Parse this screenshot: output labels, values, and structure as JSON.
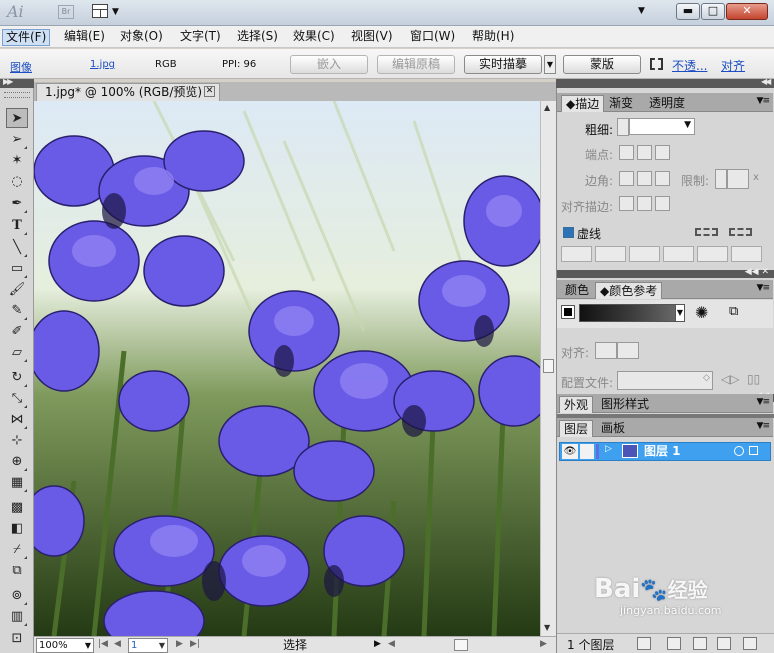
{
  "titlebar": {
    "app_logo": "Ai",
    "bridge_logo": "Br",
    "window_buttons": {
      "minimize": "▬",
      "maximize": "□",
      "close": "✕"
    }
  },
  "menu": {
    "items": [
      "文件(F)",
      "编辑(E)",
      "对象(O)",
      "文字(T)",
      "选择(S)",
      "效果(C)",
      "视图(V)",
      "窗口(W)",
      "帮助(H)"
    ]
  },
  "control_bar": {
    "image_label": "图像",
    "file_link": "1.jpg",
    "color_mode": "RGB",
    "ppi": "PPI: 96",
    "embed_button": "嵌入",
    "edit_original_button": "编辑原稿",
    "live_trace_button": "实时描摹",
    "mask_button": "蒙版",
    "opacity_link": "不透...",
    "align_link": "对齐"
  },
  "document": {
    "tab_title": "1.jpg* @ 100% (RGB/预览)",
    "tab_close": "✕"
  },
  "status_bar": {
    "zoom": "100%",
    "page": "1",
    "tool_status": "选择"
  },
  "stroke_panel": {
    "tabs": [
      "描边",
      "渐变",
      "透明度"
    ],
    "weight_label": "粗细:",
    "cap_label": "端点:",
    "corner_label": "边角:",
    "limit_label": "限制:",
    "limit_unit": "x",
    "align_label": "对齐描边:",
    "dashed_label": "虚线"
  },
  "color_panel": {
    "tabs": [
      "颜色",
      "颜色参考"
    ],
    "align_label": "对齐:",
    "preset_label": "配置文件:"
  },
  "appearance_panel": {
    "tabs": [
      "外观",
      "图形样式"
    ]
  },
  "layers_panel": {
    "tabs": [
      "图层",
      "画板"
    ],
    "layer_name": "图层 1",
    "footer_count": "1 个图层"
  },
  "watermark": {
    "brand": "Bai",
    "brand_tail": "经验",
    "url": "jingyan.baidu.com"
  },
  "colors": {
    "selection_blue": "#3ea0ee",
    "link_blue": "#1c4ec2",
    "flower_purple": "#6b5be8"
  }
}
